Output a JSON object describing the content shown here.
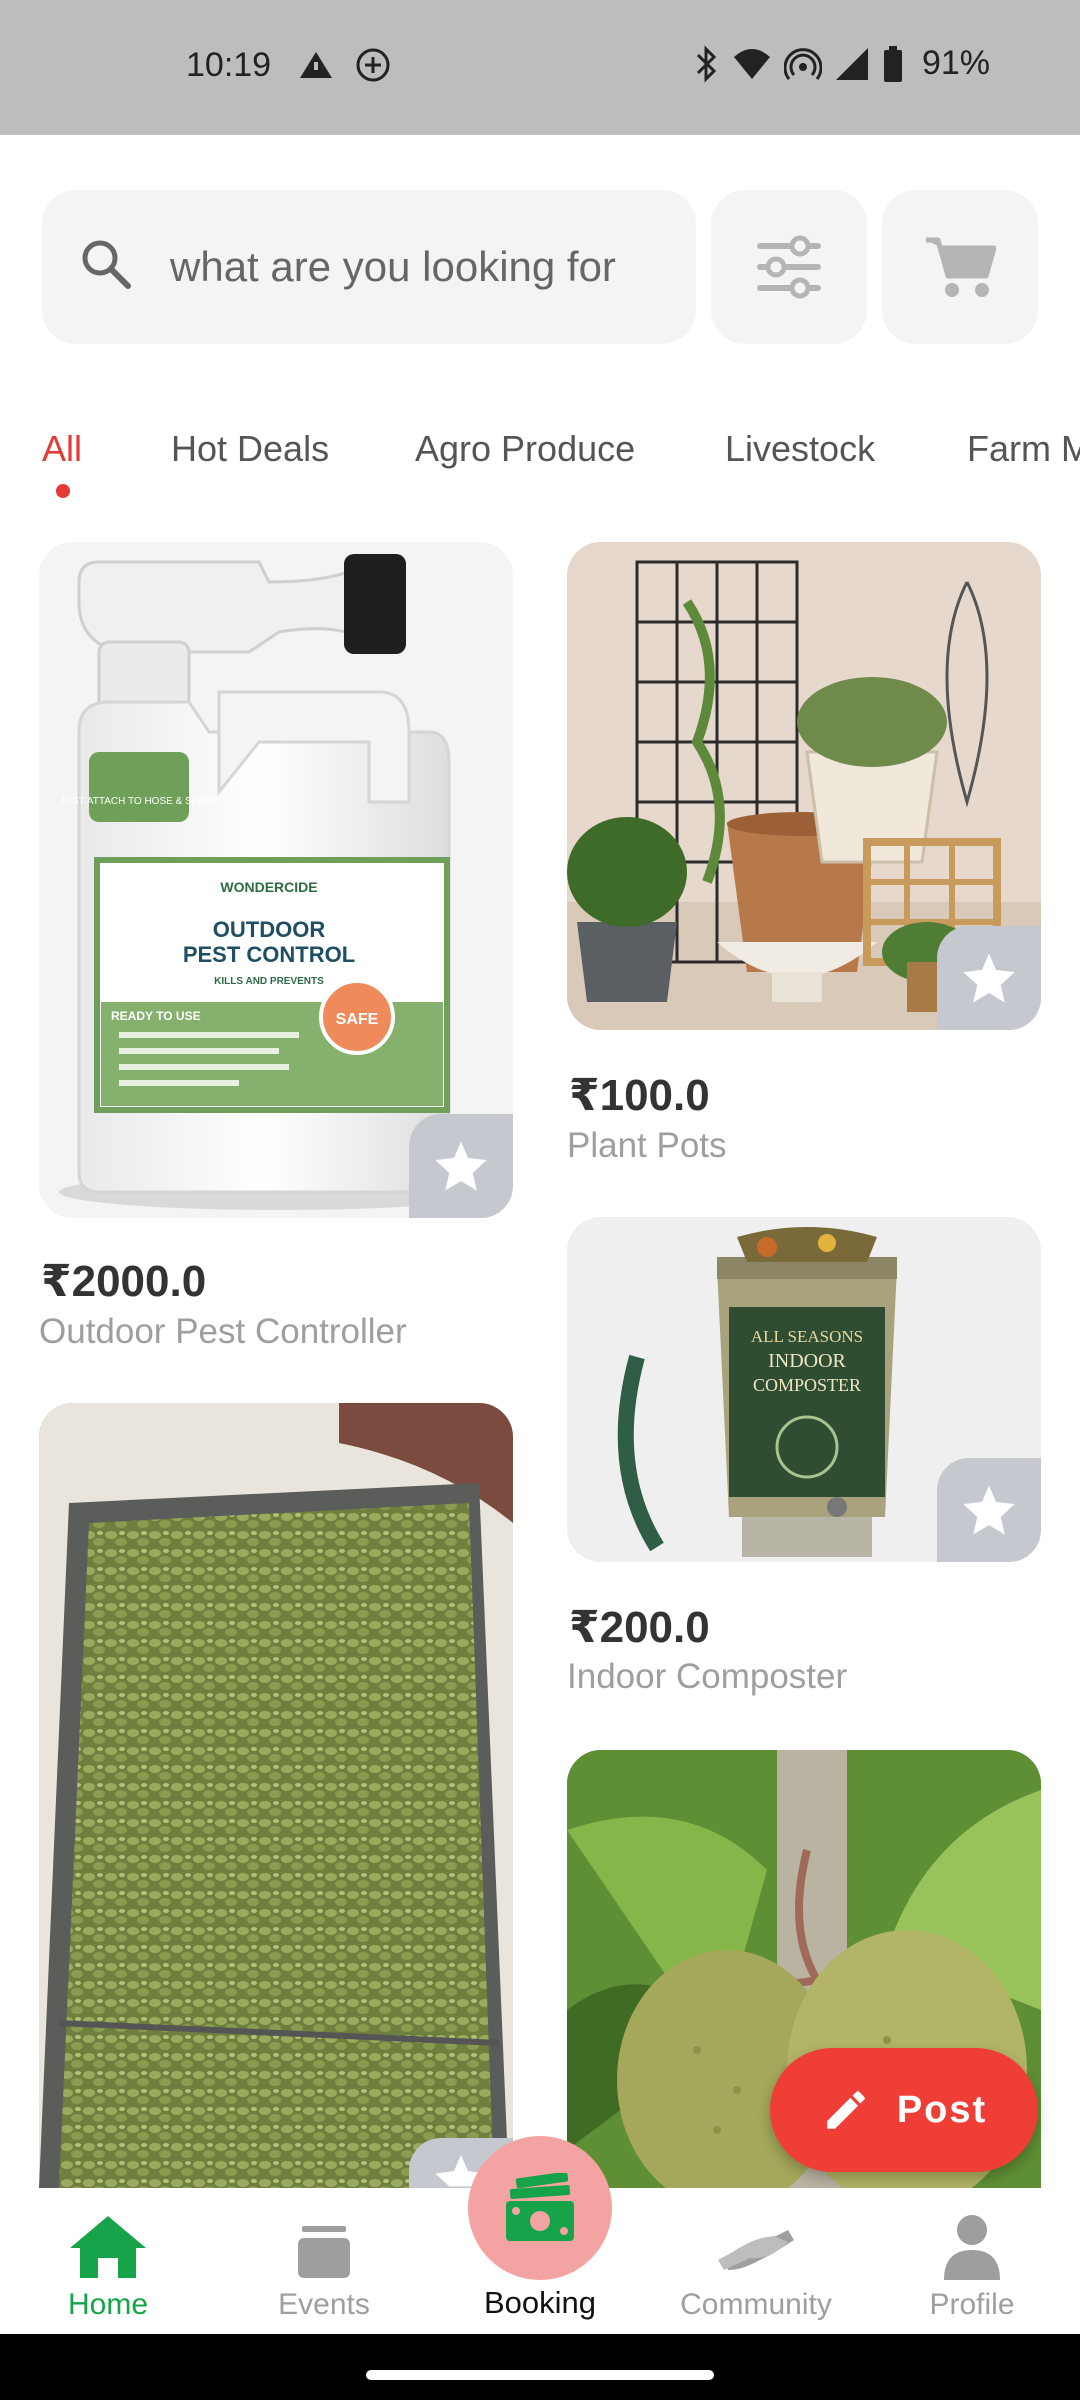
{
  "status_bar": {
    "time": "10:19",
    "battery_pct": "91%",
    "icons_left": [
      "signal-alert-icon",
      "add-circle-icon"
    ],
    "icons_right": [
      "bluetooth-icon",
      "wifi-icon",
      "hotspot-icon",
      "cell-signal-icon",
      "battery-icon"
    ]
  },
  "search": {
    "placeholder": "what are you looking for"
  },
  "tabs": [
    "All",
    "Hot Deals",
    "Agro Produce",
    "Livestock",
    "Farm M"
  ],
  "active_tab": "All",
  "products": [
    {
      "price": "₹2000.0",
      "name": "Outdoor Pest Controller"
    },
    {
      "price": "₹100.0",
      "name": "Plant Pots"
    },
    {
      "price": "₹200.0",
      "name": "Indoor Composter"
    },
    {
      "price": "",
      "name": ""
    },
    {
      "price": "",
      "name": ""
    }
  ],
  "pest_label": {
    "brand": "WONDERCIDE",
    "title_line1": "OUTDOOR",
    "title_line2": "PEST CONTROL",
    "kills": "KILLS AND PREVENTS",
    "ready": "READY TO USE",
    "attach": "JUST ATTACH TO HOSE & SPRAY",
    "safe": "SAFE"
  },
  "composter_label": {
    "line1": "ALL SEASONS",
    "line2": "INDOOR",
    "line3": "COMPOSTER"
  },
  "fab": {
    "label": "Post"
  },
  "bottom_nav": {
    "home": "Home",
    "events": "Events",
    "booking": "Booking",
    "community": "Community",
    "profile": "Profile"
  },
  "colors": {
    "accent_red": "#e53935",
    "fab_red": "#ef3e36",
    "active_green": "#17a34a",
    "booking_pink": "#f4a3a3"
  }
}
